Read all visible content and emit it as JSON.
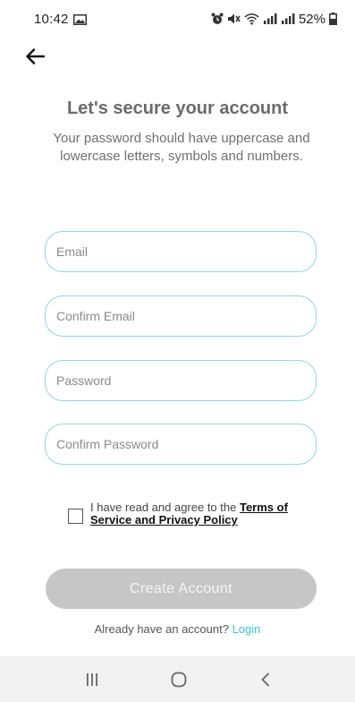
{
  "status_bar": {
    "time": "10:42",
    "battery": "52%",
    "icons": [
      "gallery-icon",
      "alarm-icon",
      "mute-icon",
      "wifi-icon",
      "signal-icon",
      "signal-icon",
      "battery-icon"
    ]
  },
  "header": {
    "back_icon": "arrow-left-icon"
  },
  "main": {
    "title": "Let's secure your account",
    "subtitle": "Your password should have uppercase and lowercase letters, symbols and numbers.",
    "fields": {
      "email_placeholder": "Email",
      "confirm_email_placeholder": "Confirm Email",
      "password_placeholder": "Password",
      "confirm_password_placeholder": "Confirm Password"
    },
    "agreement": {
      "text": "I have read and agree to the ",
      "link": "Terms of Service and Privacy Policy"
    },
    "create_button_label": "Create Account",
    "login_prompt": "Already have an account? ",
    "login_link": "Login"
  },
  "nav_bar": {
    "icons": [
      "recents-icon",
      "home-icon",
      "back-icon"
    ]
  },
  "colors": {
    "field_border": "#8fd8e0",
    "button_disabled": "#c6c6c6",
    "link_accent": "#3cc3d6"
  }
}
